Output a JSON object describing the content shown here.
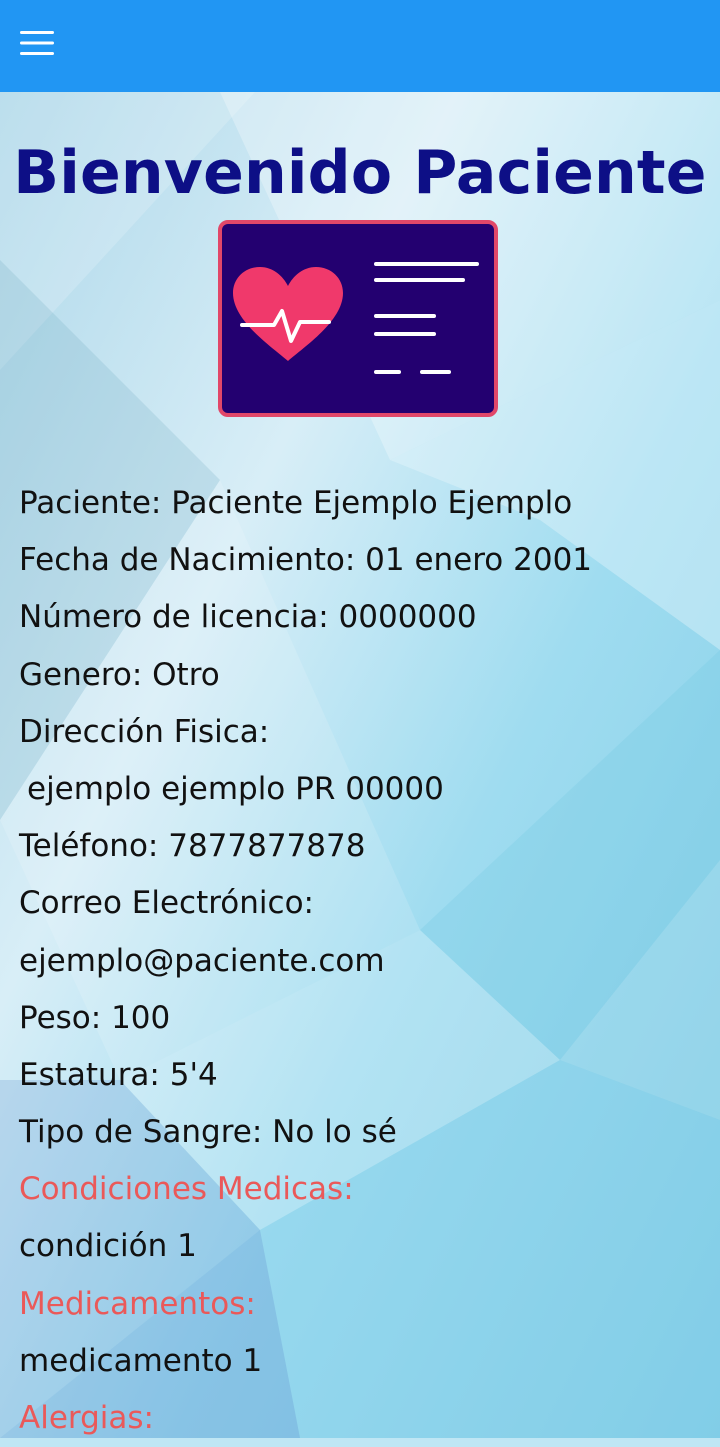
{
  "app_bar": {
    "menu_icon": "hamburger-menu-icon",
    "color": "#2196f3"
  },
  "page": {
    "title": "Bienvenido Paciente",
    "title_color": "#0d0f86",
    "hero_icon": "medical-record-heart-icon",
    "section_label_color": "#ea5959"
  },
  "patient": {
    "name_line": "Paciente: Paciente Ejemplo Ejemplo",
    "birth_line": "Fecha de Nacimiento: 01 enero 2001",
    "license_line": "Número de licencia: 0000000",
    "gender_line": "Genero: Otro",
    "address_label": "Dirección Fisica:",
    "address_value": "ejemplo ejemplo PR 00000",
    "phone_line": "Teléfono: 7877877878",
    "email_label": "Correo Electrónico:",
    "email_value": "ejemplo@paciente.com",
    "weight_line": "Peso: 100",
    "height_line": "Estatura: 5'4",
    "blood_line": "Tipo de Sangre: No lo sé",
    "conditions_label": "Condiciones Medicas:",
    "condition_1": "condición 1",
    "medications_label": "Medicamentos:",
    "medication_1": "medicamento 1",
    "allergies_label": "Alergias:"
  }
}
